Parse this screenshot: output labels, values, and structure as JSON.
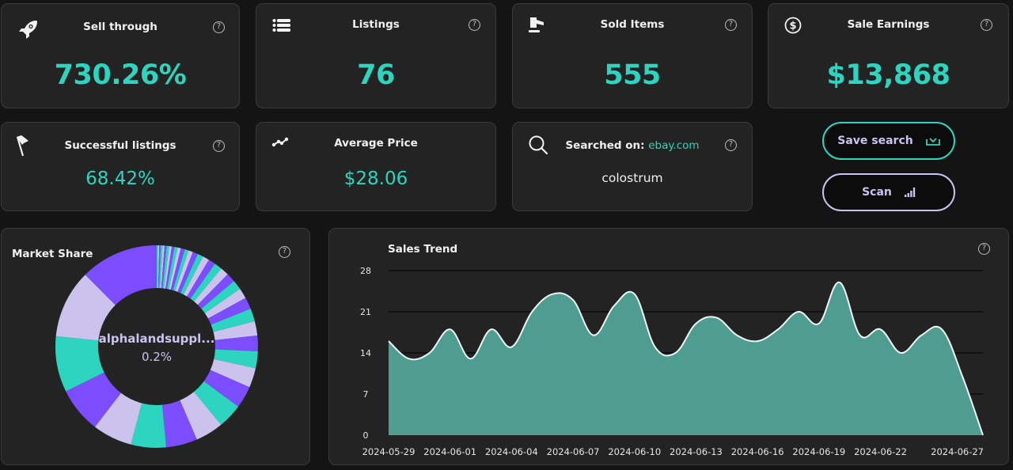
{
  "metrics": {
    "sell_through": {
      "label": "Sell through",
      "value": "730.26%",
      "icon": "rocket-icon"
    },
    "listings": {
      "label": "Listings",
      "value": "76",
      "icon": "list-icon"
    },
    "sold_items": {
      "label": "Sold Items",
      "value": "555",
      "icon": "gavel-icon"
    },
    "sale_earnings": {
      "label": "Sale Earnings",
      "value": "$13,868",
      "icon": "dollar-circle-icon"
    },
    "successful_listings": {
      "label": "Successful listings",
      "value": "68.42%",
      "icon": "flag-icon"
    },
    "average_price": {
      "label": "Average Price",
      "value": "$28.06",
      "icon": "trend-line-icon"
    },
    "searched_on": {
      "label": "Searched on:",
      "site": "ebay.com",
      "query": "colostrum",
      "icon": "search-icon"
    }
  },
  "help_glyph": "?",
  "buttons": {
    "save_search": {
      "label": "Save search",
      "icon": "tray-download-icon"
    },
    "scan": {
      "label": "Scan",
      "icon": "signal-bars-icon"
    }
  },
  "colors": {
    "accent_teal": "#2dd4bf",
    "accent_purple": "#7c4dff",
    "accent_lavender": "#cbc3ee",
    "area_fill": "#4f9c91"
  },
  "market_share": {
    "title": "Market Share",
    "center_label": "alphalandsuppl...",
    "center_value": "0.2%"
  },
  "sales_trend": {
    "title": "Sales Trend"
  },
  "chart_data": [
    {
      "type": "area",
      "title": "Sales Trend",
      "xlabel": "",
      "ylabel": "",
      "ylim": [
        0,
        28
      ],
      "yticks": [
        0,
        7,
        14,
        21,
        28
      ],
      "grid": true,
      "x_tick_labels": [
        "2024-05-29",
        "2024-06-01",
        "2024-06-04",
        "2024-06-07",
        "2024-06-10",
        "2024-06-13",
        "2024-06-16",
        "2024-06-19",
        "2024-06-22",
        "2024-06-27"
      ],
      "x": [
        "2024-05-29",
        "2024-05-30",
        "2024-05-31",
        "2024-06-01",
        "2024-06-02",
        "2024-06-03",
        "2024-06-04",
        "2024-06-05",
        "2024-06-06",
        "2024-06-07",
        "2024-06-08",
        "2024-06-09",
        "2024-06-10",
        "2024-06-11",
        "2024-06-12",
        "2024-06-13",
        "2024-06-14",
        "2024-06-15",
        "2024-06-16",
        "2024-06-17",
        "2024-06-18",
        "2024-06-19",
        "2024-06-20",
        "2024-06-21",
        "2024-06-22",
        "2024-06-23",
        "2024-06-24",
        "2024-06-25",
        "2024-06-26",
        "2024-06-27"
      ],
      "values": [
        16,
        13,
        14,
        18,
        13,
        18,
        15,
        21,
        24,
        23,
        17,
        22,
        24,
        15,
        14,
        19,
        20,
        17,
        16,
        18,
        21,
        19,
        26,
        17,
        18,
        14,
        17,
        18,
        10,
        0
      ]
    },
    {
      "type": "pie",
      "title": "Market Share",
      "donut": true,
      "highlighted": {
        "label": "alphalandsuppl...",
        "value": 0.2
      },
      "slices": [
        0.2,
        0.2,
        0.2,
        0.3,
        0.3,
        0.3,
        0.4,
        0.4,
        0.4,
        0.5,
        0.5,
        0.6,
        0.6,
        0.7,
        0.8,
        0.9,
        1.0,
        1.1,
        1.2,
        1.3,
        1.4,
        1.5,
        1.6,
        1.8,
        2.0,
        2.2,
        2.4,
        2.6,
        3.0,
        3.4,
        3.8,
        4.3,
        4.8,
        5.4,
        6.1,
        7.0,
        8.6,
        10.5,
        12.0
      ],
      "color_cycle": [
        "#7c4dff",
        "#cbc3ee",
        "#2dd4bf"
      ]
    }
  ]
}
